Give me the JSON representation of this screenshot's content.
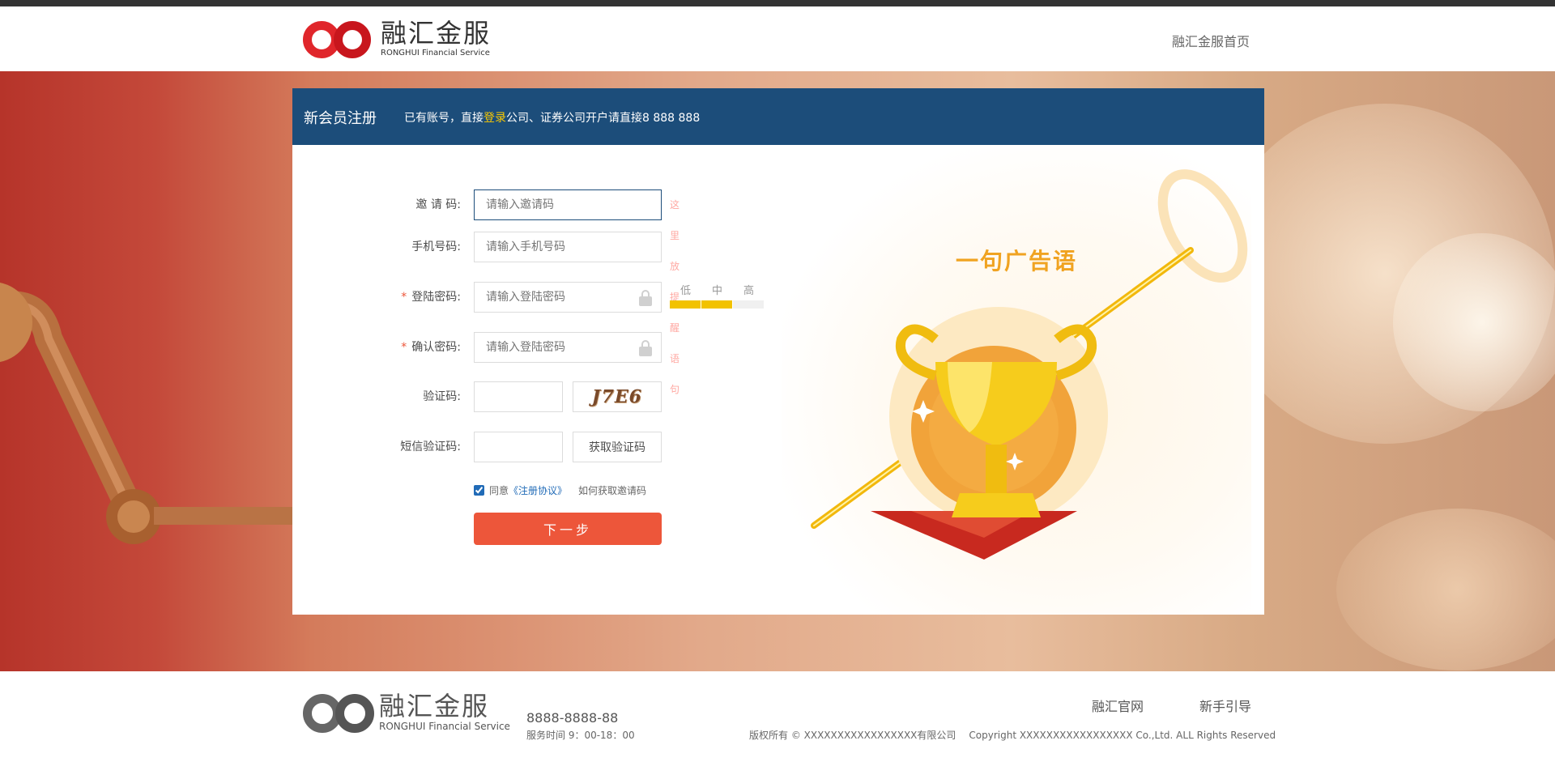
{
  "header": {
    "brand_cn": "融汇金服",
    "brand_en": "RONGHUI Financial Service",
    "home_link": "融汇金服首页"
  },
  "panel": {
    "title": "新会员注册",
    "hint_prefix": "已有账号，直接",
    "hint_login": "登录",
    "hint_suffix": "公司、证券公司开户请直接",
    "hint_phone": "8 888 888"
  },
  "form": {
    "invite": {
      "label": "邀 请 码:",
      "placeholder": "请输入邀请码",
      "tip": "这里放提醒语句"
    },
    "phone": {
      "label": "手机号码:",
      "placeholder": "请输入手机号码"
    },
    "password": {
      "label": "登陆密码:",
      "placeholder": "请输入登陆密码",
      "required": "*"
    },
    "confirm": {
      "label": "确认密码:",
      "placeholder": "请输入登陆密码",
      "required": "*"
    },
    "captcha": {
      "label": "验证码:",
      "code": "J7E6"
    },
    "sms": {
      "label": "短信验证码:",
      "button": "获取验证码"
    },
    "strength": {
      "labels": [
        "低",
        "中",
        "高"
      ],
      "level": 2
    },
    "agree": {
      "text": "同意",
      "protocol": "《注册协议》",
      "how": "如何获取邀请码",
      "checked": true
    },
    "next": "下一步"
  },
  "ad": {
    "slogan": "一句广告语"
  },
  "footer": {
    "brand_cn": "融汇金服",
    "brand_en": "RONGHUI Financial Service",
    "phone": "8888-8888-88",
    "hours": "服务时间    9：00-18：00",
    "link_official": "融汇官网",
    "link_guide": "新手引导",
    "copyright_cn": "版权所有 © XXXXXXXXXXXXXXXXX有限公司",
    "copyright_en": "Copyright XXXXXXXXXXXXXXXXX Co.,Ltd. ALL Rights Reserved"
  },
  "colors": {
    "brand_blue": "#1c4d7a",
    "accent_orange": "#ed563a",
    "login_yellow": "#fcca00",
    "link_blue": "#216bb7",
    "tip_pink": "#ffa8a2"
  }
}
